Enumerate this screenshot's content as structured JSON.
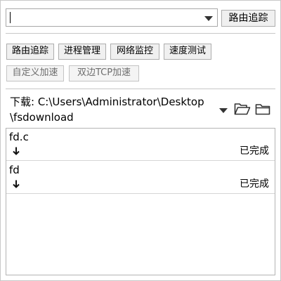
{
  "toolbar": {
    "route_combo_value": "",
    "route_trace_button": "路由追踪"
  },
  "tools": [
    {
      "label": "路由追踪"
    },
    {
      "label": "进程管理"
    },
    {
      "label": "网络监控"
    },
    {
      "label": "速度测试"
    },
    {
      "label": "自定义加速"
    },
    {
      "label": "双边TCP加速"
    }
  ],
  "download": {
    "label_line1": "下载: C:\\Users\\Administrator\\Desktop",
    "label_line2": "\\fsdownload"
  },
  "downloads": [
    {
      "name": "fd.c",
      "status": "已完成",
      "icon": "down-arrow-icon"
    },
    {
      "name": "fd",
      "status": "已完成",
      "icon": "down-arrow-icon"
    }
  ],
  "icons": {
    "dropdown": "chevron-down-icon",
    "open_folder": "folder-open-icon",
    "folder": "folder-icon"
  }
}
